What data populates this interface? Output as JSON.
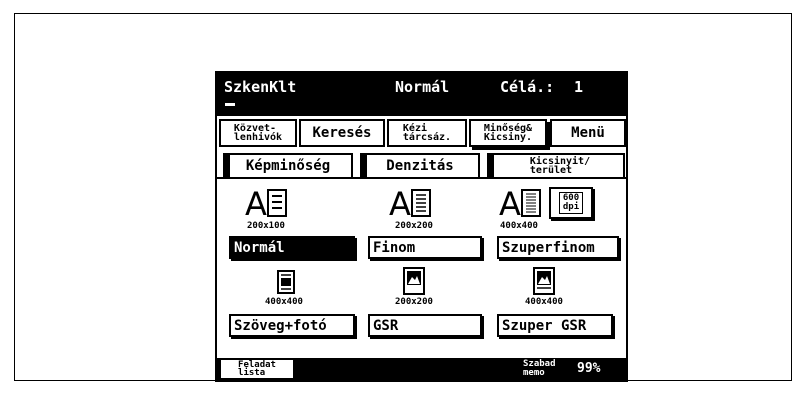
{
  "header": {
    "mode": "SzkenKlt",
    "quality": "Normál",
    "dest_label": "Célá.:",
    "dest_count": "1"
  },
  "top_buttons": {
    "direct": [
      "Közvet-",
      "lenhivók"
    ],
    "search": "Keresés",
    "manual": [
      "Kézi",
      "tárcsáz."
    ],
    "quality_size": [
      "Minőség&",
      "Kicsiny."
    ],
    "menu": "Menü"
  },
  "tabs": {
    "image_quality": "Képminőség",
    "density": "Denzitás",
    "reduce": [
      "Kicsinyit/",
      "terület"
    ]
  },
  "dpi_button": [
    "600",
    "dpi"
  ],
  "row1": {
    "res": [
      "200x100",
      "200x200",
      "400x400"
    ],
    "options": [
      "Normál",
      "Finom",
      "Szuperfinom"
    ]
  },
  "row2": {
    "res": [
      "400x400",
      "200x200",
      "400x400"
    ],
    "options": [
      "Szöveg+fotó",
      "GSR",
      "Szuper GSR"
    ]
  },
  "footer": {
    "job_list": [
      "Feladat",
      "lista"
    ],
    "free_label": [
      "Szabad",
      "memo"
    ],
    "free_value": "99%"
  },
  "colors": {
    "screen_bg": "#ffffff",
    "bar_bg": "#000000",
    "text": "#000000"
  }
}
